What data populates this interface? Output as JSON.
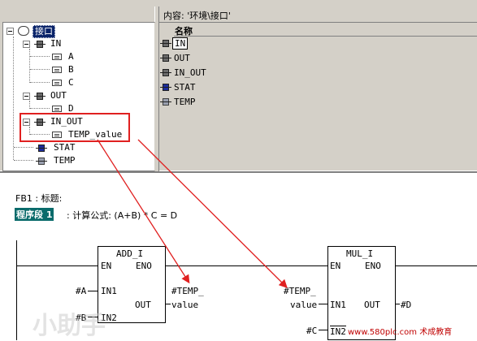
{
  "content_label": "内容: '环境\\接口'",
  "list_header": "名称",
  "list_items": [
    "IN",
    "OUT",
    "IN_OUT",
    "STAT",
    "TEMP"
  ],
  "tree": {
    "root": "接口",
    "in": "IN",
    "in_children": [
      "A",
      "B",
      "C"
    ],
    "out": "OUT",
    "out_children": [
      "D"
    ],
    "inout": "IN_OUT",
    "inout_children": [
      "TEMP_value"
    ],
    "stat": "STAT",
    "temp": "TEMP"
  },
  "editor": {
    "block_title": "FB1 : 标题:",
    "network_label": "程序段 1",
    "network_comment": ": 计算公式: (A+B) * C = D",
    "add_block": {
      "name": "ADD_I",
      "en": "EN",
      "eno": "ENO",
      "in1": "IN1",
      "in2": "IN2",
      "out": "OUT",
      "in1_param": "#A",
      "in2_param": "#B",
      "out_param_1": "#TEMP_",
      "out_param_2": "value"
    },
    "mul_block": {
      "name": "MUL_I",
      "en": "EN",
      "eno": "ENO",
      "in1": "IN1",
      "in2": "IN2",
      "out": "OUT",
      "in1_param_1": "#TEMP_",
      "in1_param_2": "value",
      "in2_param": "#C",
      "out_param": "#D"
    }
  },
  "watermark": "www.580plc.com 术成教育",
  "colors": {
    "highlight_red": "#e02020",
    "network_bg": "#0a6b6b",
    "selected_bg": "#0a246a",
    "stat_icon": "#1c2c9c"
  }
}
